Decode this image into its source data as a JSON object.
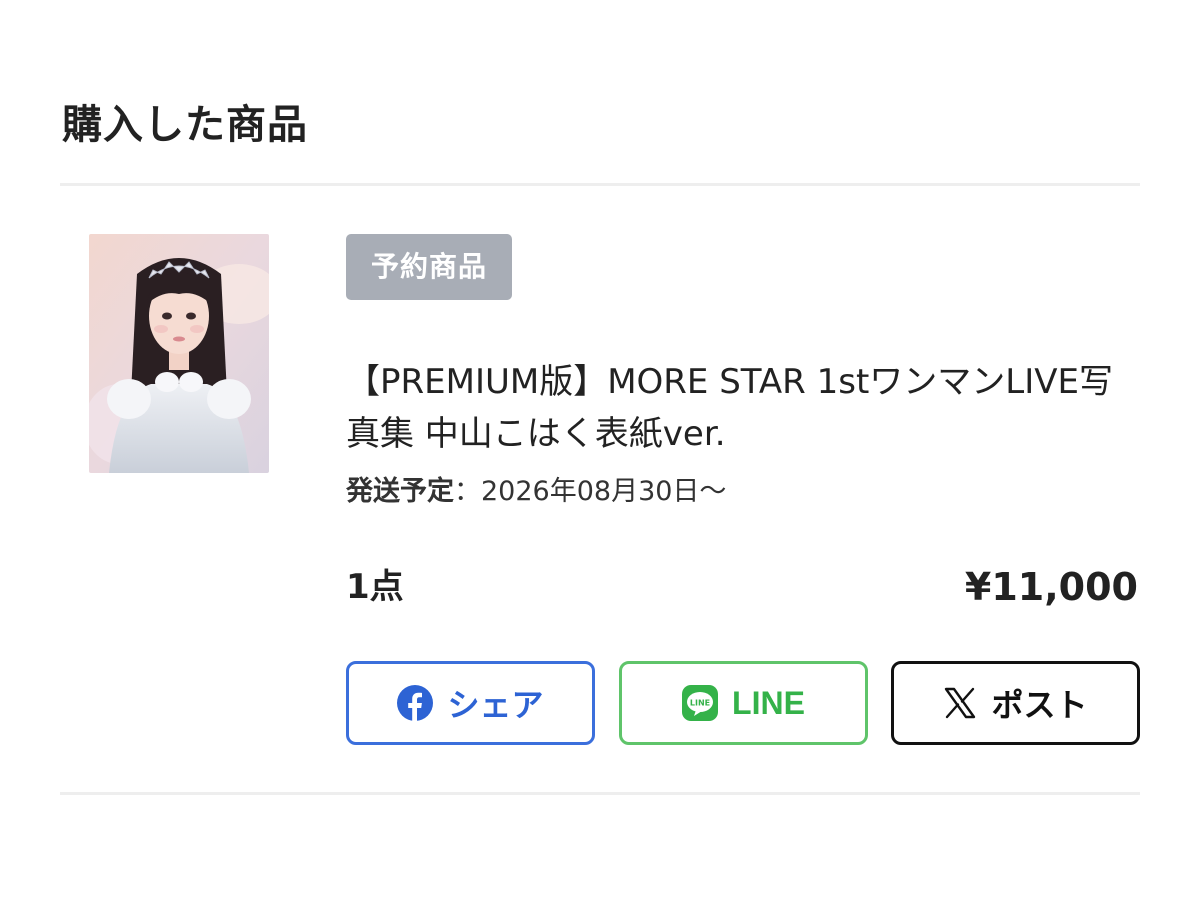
{
  "section": {
    "title": "購入した商品"
  },
  "product": {
    "badge": "予約商品",
    "name": "【PREMIUM版】MORE STAR 1stワンマンLIVE写真集 中山こはく表紙ver.",
    "shipping_label": "発送予定",
    "shipping_separator": "：",
    "shipping_date": "2026年08月30日〜",
    "quantity": "1点",
    "price": "¥11,000",
    "thumbnail_icon": "product-photo"
  },
  "share": {
    "facebook_label": "シェア",
    "line_label": "LINE",
    "x_label": "ポスト",
    "facebook_icon": "facebook-icon",
    "line_icon": "line-icon",
    "x_icon": "x-logo-icon"
  },
  "colors": {
    "badge_bg": "#a8adb6",
    "facebook": "#2d63d4",
    "line": "#34b249",
    "x": "#111111"
  }
}
